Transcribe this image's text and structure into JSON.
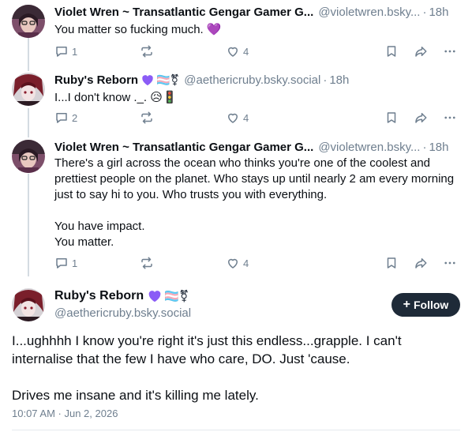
{
  "posts": [
    {
      "author_name": "Violet Wren ~ Transatlantic Gengar Gamer G...",
      "author_handle": "@violetwren.bsky...",
      "time_ago": "18h",
      "name_badges": "",
      "text": "You matter so fucking much. 💜",
      "reply_count": "1",
      "repost_count": "",
      "like_count": "4"
    },
    {
      "author_name": "Ruby's Reborn",
      "author_handle": "@aethericruby.bsky.social",
      "time_ago": "18h",
      "name_badges": "🏳️‍⚧️⚧",
      "text": "I...I don't know ._. 😥🚦",
      "reply_count": "2",
      "repost_count": "",
      "like_count": "4"
    },
    {
      "author_name": "Violet Wren ~ Transatlantic Gengar Gamer G...",
      "author_handle": "@violetwren.bsky...",
      "time_ago": "18h",
      "name_badges": "",
      "text": "There's a girl across the ocean who thinks you're one of the coolest and prettiest people on the planet. Who stays up until nearly 2 am every morning just to say hi to you. Who trusts you with everything.\n\nYou have impact.\nYou matter.",
      "reply_count": "1",
      "repost_count": "",
      "like_count": "4"
    }
  ],
  "main_post": {
    "author_name": "Ruby's Reborn",
    "author_handle": "@aethericruby.bsky.social",
    "follow_label": "Follow",
    "text": "I...ughhhh I know you're right it's just this endless...grapple. I can't internalise that the few I have who care, DO. Just 'cause.\n\nDrives me insane and it's killing me lately.",
    "timestamp": "10:07 AM · Jun 2, 2026"
  },
  "separator": "·",
  "colors": {
    "accent_heart": "#8b5cf6",
    "muted_text": "#6f7f8f",
    "follow_button_bg": "#1e2a38",
    "thread_line": "#d4dbe2"
  },
  "icons": {
    "reply": "reply-icon",
    "repost": "repost-icon",
    "like": "heart-outline-icon",
    "bookmark": "bookmark-icon",
    "share": "share-icon",
    "more": "more-options-icon"
  }
}
